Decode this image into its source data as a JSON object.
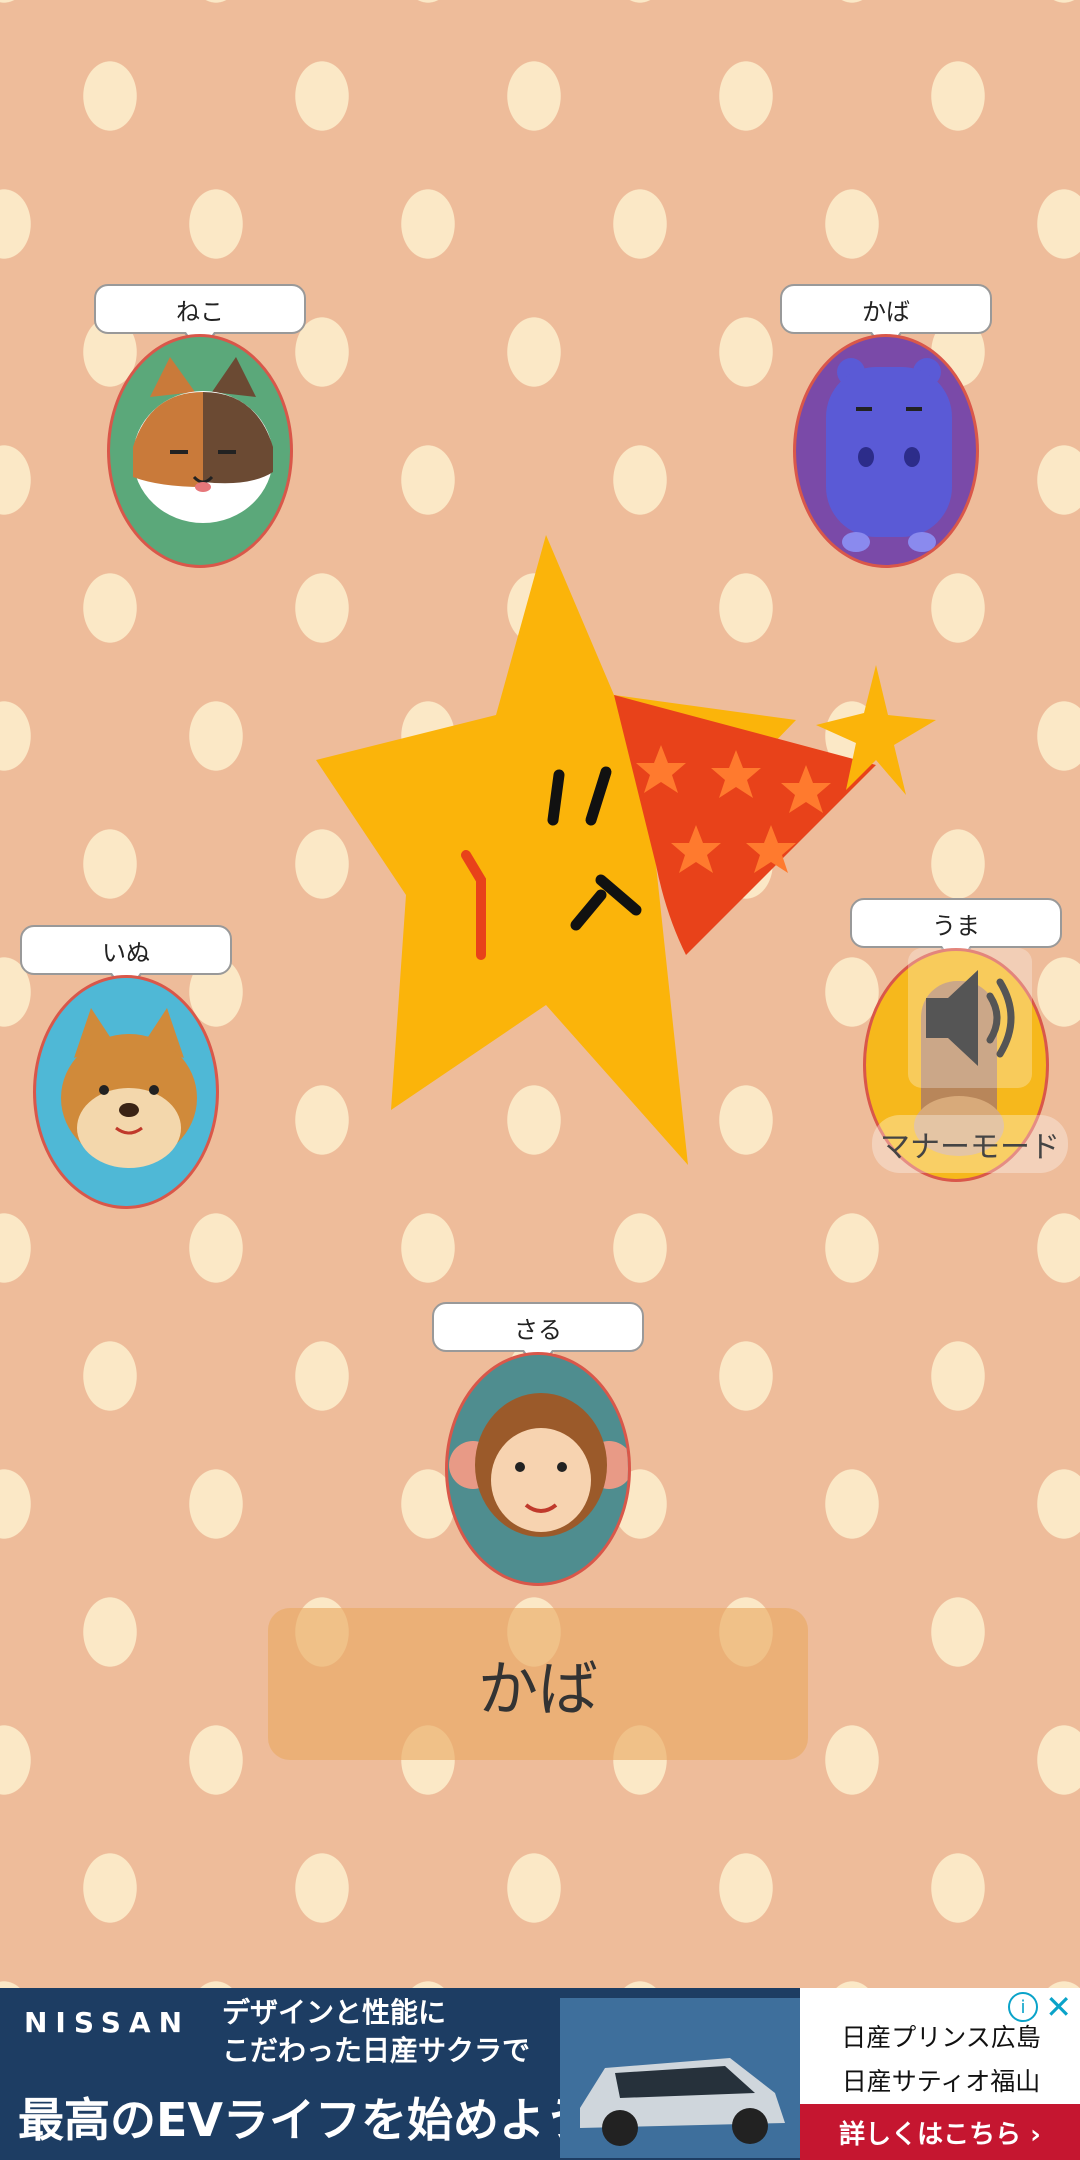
{
  "animals": [
    {
      "id": "cat",
      "label": "ねこ",
      "color": "#5ba87a"
    },
    {
      "id": "hippo",
      "label": "かば",
      "color": "#7a4aa8"
    },
    {
      "id": "dog",
      "label": "いぬ",
      "color": "#4fb8d6"
    },
    {
      "id": "horse",
      "label": "うま",
      "color": "#f6b81c"
    },
    {
      "id": "monkey",
      "label": "さる",
      "color": "#4f8d8f"
    }
  ],
  "answer": {
    "text": "かば"
  },
  "manner_mode": {
    "label": "マナーモード",
    "icon": "speaker-icon"
  },
  "ad": {
    "brand": "NISSAN",
    "tagline_1": "デザインと性能に",
    "tagline_2": "こだわった日産サクラで",
    "main": "最高のEVライフを始めよう",
    "dealer_1": "日産プリンス広島",
    "dealer_2": "日産サティオ福山",
    "cta": "詳しくはこちら ›",
    "info_icon": "info-icon",
    "close_icon": "close-icon"
  },
  "colors": {
    "background": "#eebc9a",
    "dots": "#fbe8c6",
    "star": "#fbb40a",
    "hat": "#e8421a",
    "answer_box": "#e8aa62"
  }
}
